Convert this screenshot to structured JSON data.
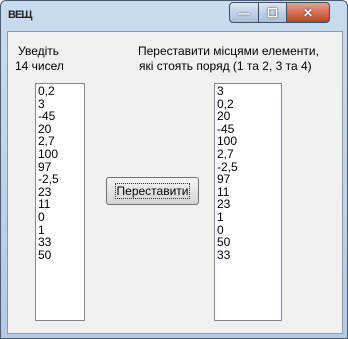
{
  "window": {
    "title_icon": "ВЕЩ",
    "controls": {
      "minimize": "—",
      "maximize": "☐",
      "close": "✕"
    }
  },
  "labels": {
    "left_line1": "Уведіть",
    "left_line2": "14 чисел",
    "right_line1": "Переставити місцями елементи,",
    "right_line2": "які стоять поряд (1 та 2, 3 та 4)"
  },
  "input_list": [
    "0,2",
    "3",
    "-45",
    "20",
    "2,7",
    "100",
    "97",
    "-2,5",
    "23",
    "11",
    "0",
    "1",
    "33",
    "50"
  ],
  "output_list": [
    "3",
    "0,2",
    "20",
    "-45",
    "100",
    "2,7",
    "-2,5",
    "97",
    "11",
    "23",
    "1",
    "0",
    "50",
    "33"
  ],
  "button": {
    "label": "Переставити"
  },
  "colors": {
    "title_bar": "#b4c9e2",
    "close_button": "#c4402a",
    "client_bg": "#f0f0f0"
  }
}
